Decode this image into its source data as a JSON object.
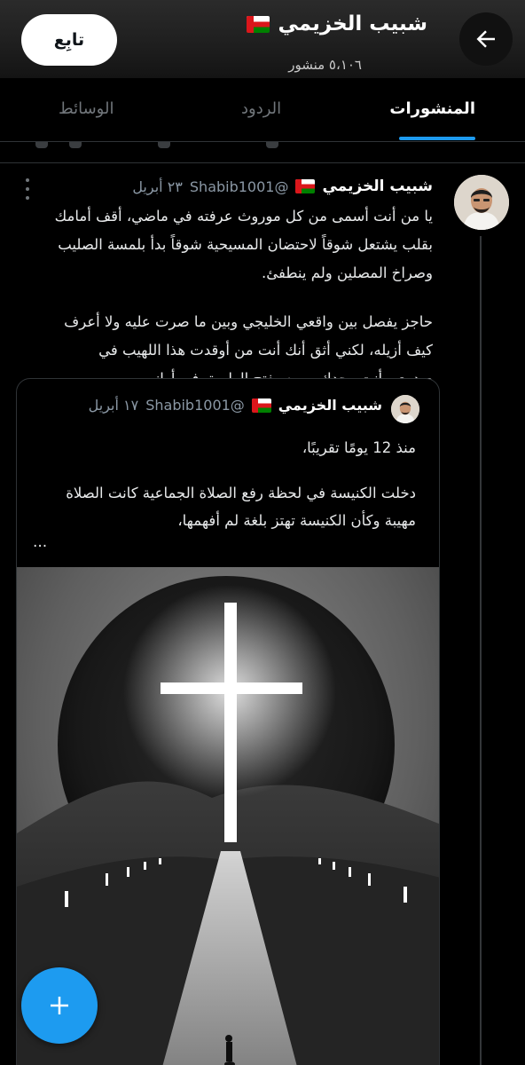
{
  "header": {
    "back_icon": "arrow-left-icon",
    "profile_name": "شبيب الخزيمي",
    "flag_icon": "oman-flag-icon",
    "post_count": "٥،١٠٦ منشور",
    "follow_label": "تابِع"
  },
  "tabs": [
    {
      "label": "المنشورات",
      "active": true
    },
    {
      "label": "الردود",
      "active": false
    },
    {
      "label": "الوسائط",
      "active": false
    }
  ],
  "colors": {
    "accent": "#1d9bf0",
    "background": "#000000",
    "muted_text": "#8b98a5"
  },
  "tweet": {
    "author_name": "شبيب الخزيمي",
    "handle": "@Shabib1001",
    "date": "٢٣ أبريل",
    "paragraph_1": "يا من أنت أسمى من كل موروث عرفته في ماضي، أقف أمامك بقلب يشتعل شوقاً لاحتضان المسيحية شوقاً بدأ بلمسة الصليب وصراخ المصلين ولم ينطفئ.",
    "paragraph_2": "حاجز يفصل بين واقعي الخليجي وبين ما صرت عليه ولا أعرف كيف أزيله، لكني أثق أنك أنت من أوقدت هذا اللهيب في صدري،وأنت وحدك من سيفتح الطريق فى أوانه."
  },
  "quoted_tweet": {
    "author_name": "شبيب الخزيمي",
    "handle": "@Shabib1001",
    "date": "١٧ أبريل",
    "line_1": "منذ 12 يومًا تقريبًا،",
    "line_2": "دخلت الكنيسة في لحظة رفع الصلاة الجماعية كانت الصلاة مهيبة وكأن الكنيسة تهتز بلغة لم أفهمها،",
    "ellipsis": "..."
  },
  "fab": {
    "icon": "plus-icon"
  }
}
